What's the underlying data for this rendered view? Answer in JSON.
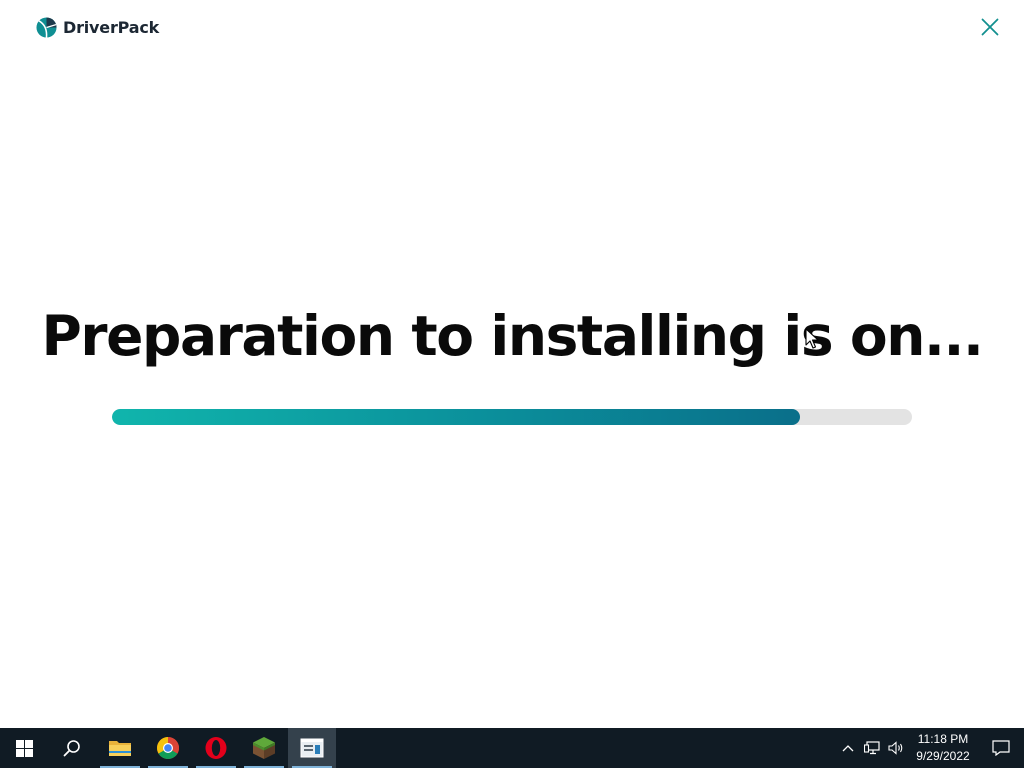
{
  "app": {
    "brand_name": "DriverPack",
    "headline": "Preparation to installing is on...",
    "progress_fraction": 0.86,
    "accent_color": "#0b8f9b"
  },
  "taskbar": {
    "items": [
      {
        "name": "start",
        "icon": "windows-logo-icon"
      },
      {
        "name": "search",
        "icon": "search-icon"
      },
      {
        "name": "file-explorer",
        "icon": "folder-icon",
        "open": true
      },
      {
        "name": "chrome",
        "icon": "chrome-icon",
        "open": true
      },
      {
        "name": "opera",
        "icon": "opera-icon",
        "open": true
      },
      {
        "name": "minecraft",
        "icon": "grass-block-icon",
        "open": true
      },
      {
        "name": "driverpack-installer",
        "icon": "app-window-icon",
        "active": true
      }
    ],
    "tray": {
      "icons": [
        "chevron-up-icon",
        "network-icon",
        "volume-icon"
      ],
      "time": "11:18 PM",
      "date": "9/29/2022"
    }
  }
}
